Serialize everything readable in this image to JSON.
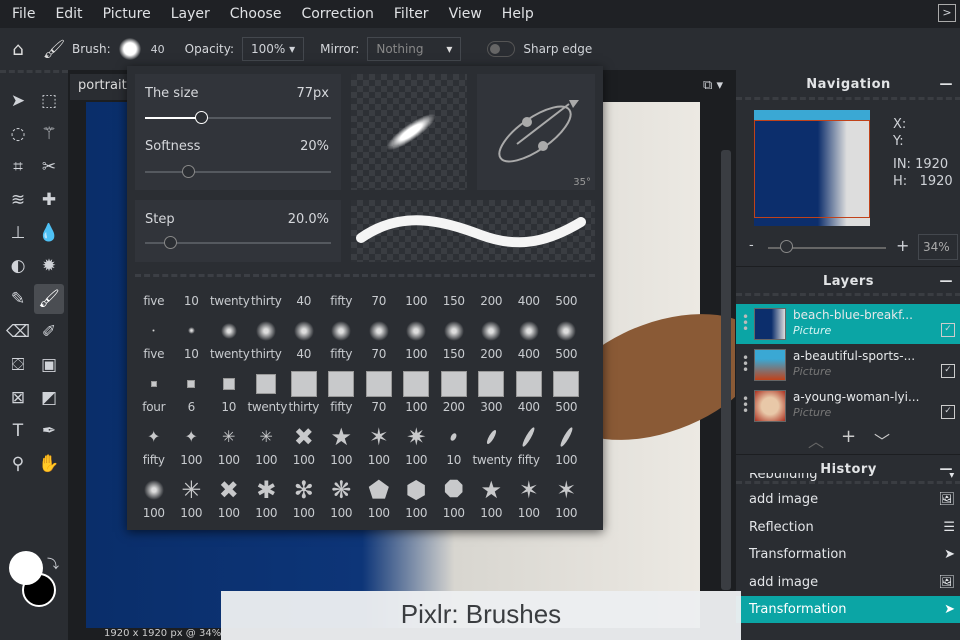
{
  "menu": [
    "File",
    "Edit",
    "Picture",
    "Layer",
    "Choose",
    "Correction",
    "Filter",
    "View",
    "Help"
  ],
  "toolbar": {
    "brush_label": "Brush:",
    "brush_size": "40",
    "opacity_label": "Opacity:",
    "opacity_value": "100%",
    "mirror_label": "Mirror:",
    "mirror_value": "Nothing",
    "sharp_edge_label": "Sharp edge",
    "sharp_edge_on": false
  },
  "document": {
    "tab": "portrait-",
    "status": "1920 x 1920 px @ 34%"
  },
  "brush_panel": {
    "size_label": "The size",
    "size_value": "77px",
    "size_fraction": 0.3,
    "softness_label": "Softness",
    "softness_value": "20%",
    "softness_fraction": 0.2,
    "step_label": "Step",
    "step_value": "20.0%",
    "step_fraction": 0.1,
    "angle": "35°",
    "header_labels": [
      "five",
      "10",
      "twenty",
      "thirty",
      "40",
      "fifty",
      "70",
      "100",
      "150",
      "200",
      "400",
      "500"
    ],
    "rows": [
      {
        "shapes": [
          "soft-circle",
          "soft-circle",
          "soft-circle",
          "soft-circle",
          "soft-circle",
          "soft-circle",
          "soft-circle",
          "soft-circle",
          "soft-circle",
          "soft-circle",
          "soft-circle",
          "soft-circle"
        ],
        "labels": [
          "five",
          "10",
          "twenty",
          "thirty",
          "40",
          "fifty",
          "70",
          "100",
          "150",
          "200",
          "400",
          "500"
        ]
      },
      {
        "shapes": [
          "square",
          "square",
          "square",
          "square",
          "square",
          "square",
          "square",
          "square",
          "square",
          "square",
          "square",
          "square"
        ],
        "labels": [
          "four",
          "6",
          "10",
          "twenty",
          "thirty",
          "fifty",
          "70",
          "100",
          "200",
          "300",
          "400",
          "500"
        ]
      },
      {
        "shapes": [
          "sparkle",
          "sparkle",
          "sparkle-thin",
          "sparkle-thin",
          "star-4",
          "star-5",
          "star-6",
          "star-8",
          "ellipse",
          "ellipse",
          "ellipse",
          "ellipse"
        ],
        "labels": [
          "fifty",
          "100",
          "100",
          "100",
          "100",
          "100",
          "100",
          "100",
          "10",
          "twenty",
          "fifty",
          "100"
        ]
      },
      {
        "shapes": [
          "soft-circle",
          "sparkle-thin",
          "cross-x",
          "star-5-blunt",
          "asterisk",
          "gear-flower",
          "pentagon",
          "hexagon",
          "octagon",
          "star-5",
          "star-6",
          "star-7"
        ],
        "labels": [
          "100",
          "100",
          "100",
          "100",
          "100",
          "100",
          "100",
          "100",
          "100",
          "100",
          "100",
          "100"
        ]
      }
    ]
  },
  "navigation": {
    "title": "Navigation",
    "x_label": "X:",
    "y_label": "Y:",
    "w_label": "IN:",
    "w_value": "1920",
    "h_label": "H:",
    "h_value": "1920",
    "zoom_minus": "-",
    "zoom_plus": "+",
    "zoom": "34%",
    "zoom_fraction": 0.1
  },
  "layers": {
    "title": "Layers",
    "items": [
      {
        "name": "beach-blue-breakf...",
        "type": "Picture",
        "active": true
      },
      {
        "name": "a-beautiful-sports-...",
        "type": "Picture",
        "active": false
      },
      {
        "name": "a-young-woman-lyi...",
        "type": "Picture",
        "active": false
      }
    ]
  },
  "history": {
    "title": "History",
    "items": [
      {
        "label": "Rebuilding",
        "icon": "chevron-down-icon"
      },
      {
        "label": "add image",
        "icon": "image-icon"
      },
      {
        "label": "Reflection",
        "icon": "document-icon"
      },
      {
        "label": "Transformation",
        "icon": "cursor-icon"
      },
      {
        "label": "add image",
        "icon": "image-icon"
      },
      {
        "label": "Transformation",
        "icon": "cursor-icon",
        "active": true
      }
    ]
  },
  "caption": "Pixlr: Brushes",
  "colors": {
    "accent": "#0ba5a5",
    "foreground": "#ffffff",
    "background": "#000000"
  }
}
